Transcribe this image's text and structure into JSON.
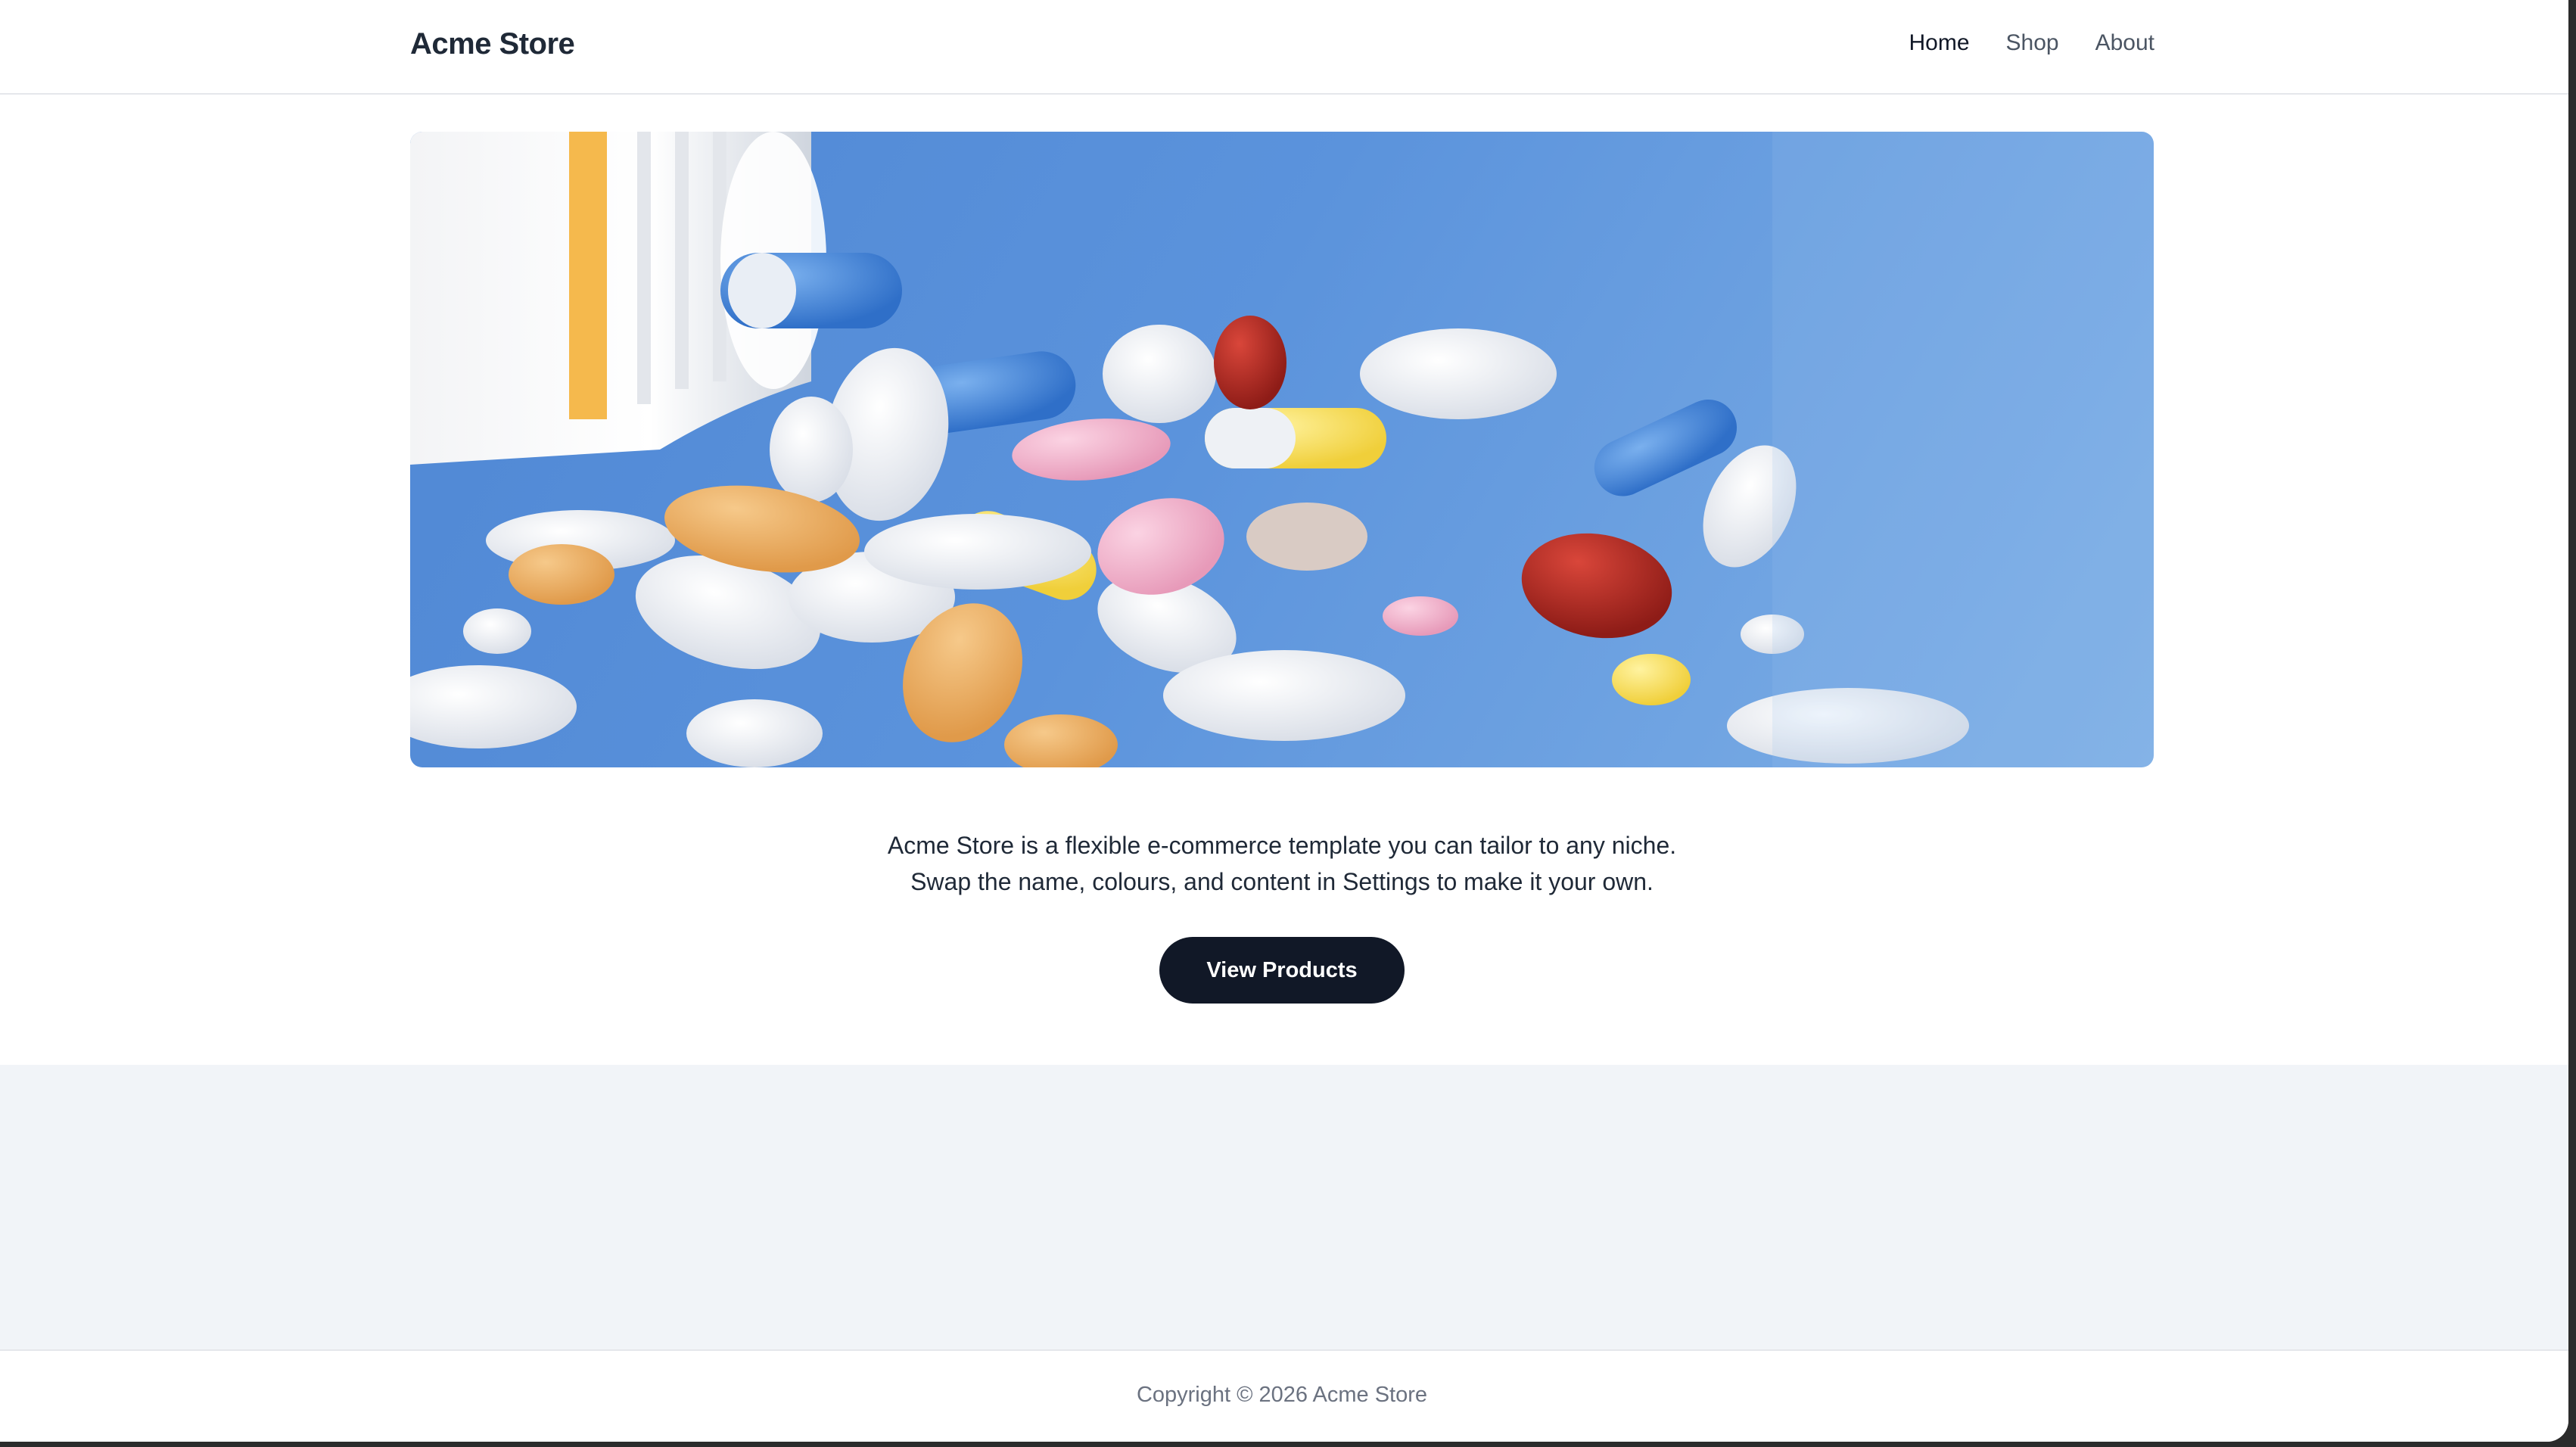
{
  "header": {
    "brand": "Acme Store",
    "nav": [
      {
        "label": "Home",
        "active": true
      },
      {
        "label": "Shop",
        "active": false
      },
      {
        "label": "About",
        "active": false
      }
    ]
  },
  "hero": {
    "image_subject": "spilled pills and capsules on blue background"
  },
  "intro": {
    "line1": "Acme Store is a flexible e-commerce template you can tailor to any niche.",
    "line2": "Swap the name, colours, and content in Settings to make it your own."
  },
  "cta": {
    "label": "View Products"
  },
  "footer": {
    "copyright": "Copyright © 2026 Acme Store"
  },
  "colors": {
    "primary_dark": "#111827",
    "hero_blue": "#5b93dc",
    "band_bg": "#f1f4f8"
  }
}
